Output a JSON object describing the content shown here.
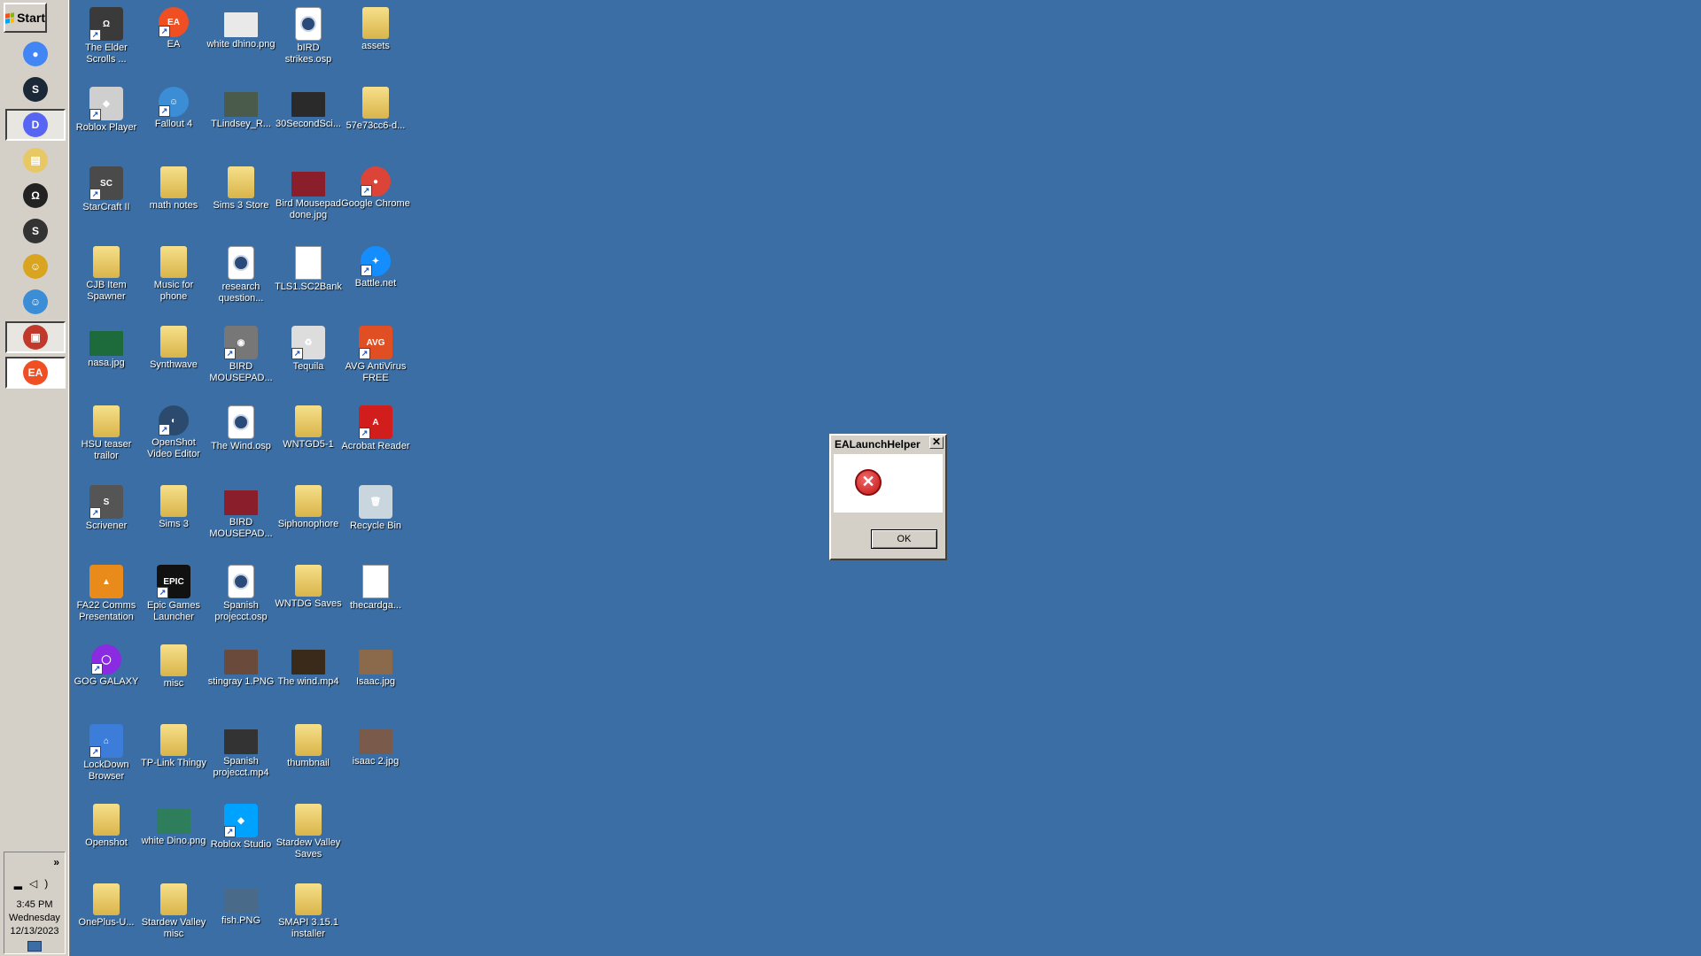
{
  "taskbar": {
    "start_label": "Start",
    "pinned": [
      {
        "name": "chrome-icon",
        "color": "#4285f4",
        "glyph": "●"
      },
      {
        "name": "steam-icon",
        "color": "#1b2838",
        "glyph": "S"
      },
      {
        "name": "discord-icon",
        "color": "#5865f2",
        "glyph": "D",
        "state": "pressed"
      },
      {
        "name": "file-explorer-icon",
        "color": "#e8c765",
        "glyph": "▤"
      },
      {
        "name": "elder-scrolls-icon",
        "color": "#222222",
        "glyph": "Ω"
      },
      {
        "name": "scrivener-icon",
        "color": "#333333",
        "glyph": "S"
      },
      {
        "name": "fallout-icon",
        "color": "#d9a520",
        "glyph": "☺"
      },
      {
        "name": "fallout-4-icon",
        "color": "#3b8ed6",
        "glyph": "☺"
      },
      {
        "name": "toolbox-icon",
        "color": "#c0392b",
        "glyph": "▣",
        "state": "pressed"
      },
      {
        "name": "ea-icon",
        "color": "#f04e23",
        "glyph": "EA",
        "state": "active"
      }
    ],
    "tray": {
      "time": "3:45 PM",
      "day": "Wednesday",
      "date": "12/13/2023",
      "chevron": "»"
    }
  },
  "desktop": {
    "columns": [
      [
        {
          "label": "The Elder Scrolls ...",
          "kind": "app",
          "color": "#3a3a3a",
          "glyph": "Ω",
          "shortcut": true
        },
        {
          "label": "Roblox Player",
          "kind": "app",
          "color": "#cfcfcf",
          "glyph": "◆",
          "shortcut": true
        },
        {
          "label": "StarCraft II",
          "kind": "app",
          "color": "#4a4a4a",
          "glyph": "SC",
          "shortcut": true
        },
        {
          "label": "CJB Item Spawner",
          "kind": "folder"
        },
        {
          "label": "nasa.jpg",
          "kind": "image",
          "color": "#1d6b3a"
        },
        {
          "label": "HSU teaser trailor",
          "kind": "folder"
        },
        {
          "label": "Scrivener",
          "kind": "app",
          "color": "#555555",
          "glyph": "S",
          "shortcut": true
        },
        {
          "label": "FA22 Comms Presentation",
          "kind": "app",
          "color": "#e98b1b",
          "glyph": "▲",
          "shortcut": false
        },
        {
          "label": "GOG GALAXY",
          "kind": "round",
          "color": "#8a2be2",
          "glyph": "◯",
          "shortcut": true
        },
        {
          "label": "LockDown Browser",
          "kind": "app",
          "color": "#3b7dd8",
          "glyph": "⌂",
          "shortcut": true
        },
        {
          "label": "Openshot",
          "kind": "folder"
        },
        {
          "label": "OnePlus-U...",
          "kind": "folder"
        }
      ],
      [
        {
          "label": "EA",
          "kind": "round",
          "color": "#f04e23",
          "glyph": "EA",
          "shortcut": true
        },
        {
          "label": "Fallout 4",
          "kind": "round",
          "color": "#3b8ed6",
          "glyph": "☺",
          "shortcut": true
        },
        {
          "label": "math notes",
          "kind": "folder"
        },
        {
          "label": "Music for phone",
          "kind": "folder"
        },
        {
          "label": "Synthwave",
          "kind": "folder"
        },
        {
          "label": "OpenShot Video Editor",
          "kind": "round",
          "color": "#2c4a6e",
          "glyph": "◐",
          "shortcut": true
        },
        {
          "label": "Sims 3",
          "kind": "folder"
        },
        {
          "label": "Epic Games Launcher",
          "kind": "app",
          "color": "#111111",
          "glyph": "EPIC",
          "shortcut": true
        },
        {
          "label": "misc",
          "kind": "folder"
        },
        {
          "label": "TP-Link Thingy",
          "kind": "folder"
        },
        {
          "label": "white Dino.png",
          "kind": "image",
          "color": "#2e7d5b"
        },
        {
          "label": "Stardew Valley misc",
          "kind": "folder"
        }
      ],
      [
        {
          "label": "white dhino.png",
          "kind": "image",
          "color": "#e9e9e9"
        },
        {
          "label": "TLindsey_R...",
          "kind": "image",
          "color": "#4b5b4b"
        },
        {
          "label": "Sims 3 Store",
          "kind": "folder"
        },
        {
          "label": "research question...",
          "kind": "osp"
        },
        {
          "label": "BIRD MOUSEPAD...",
          "kind": "app",
          "color": "#777777",
          "glyph": "◉",
          "shortcut": true
        },
        {
          "label": "The Wind.osp",
          "kind": "osp"
        },
        {
          "label": "BIRD MOUSEPAD...",
          "kind": "image",
          "color": "#8a1e2b"
        },
        {
          "label": "Spanish projecct.osp",
          "kind": "osp"
        },
        {
          "label": "stingray 1.PNG",
          "kind": "image",
          "color": "#6a4a3a"
        },
        {
          "label": "Spanish projecct.mp4",
          "kind": "image",
          "color": "#333333"
        },
        {
          "label": "Roblox Studio",
          "kind": "app",
          "color": "#00a2ff",
          "glyph": "◆",
          "shortcut": true
        },
        {
          "label": "fish.PNG",
          "kind": "image",
          "color": "#4a6a8a"
        }
      ],
      [
        {
          "label": "bIRD strikes.osp",
          "kind": "osp"
        },
        {
          "label": "30SecondSci...",
          "kind": "image",
          "color": "#2a2a2a"
        },
        {
          "label": "Bird Mousepad done.jpg",
          "kind": "image",
          "color": "#8a1e2b"
        },
        {
          "label": "TLS1.SC2Bank",
          "kind": "file"
        },
        {
          "label": "Tequila",
          "kind": "app",
          "color": "#dddddd",
          "glyph": "♻",
          "shortcut": true
        },
        {
          "label": "WNTGD5-1",
          "kind": "folder"
        },
        {
          "label": "Siphonophore",
          "kind": "folder"
        },
        {
          "label": "WNTDG Saves",
          "kind": "folder"
        },
        {
          "label": "The wind.mp4",
          "kind": "image",
          "color": "#3a2a1a"
        },
        {
          "label": "thumbnail",
          "kind": "folder"
        },
        {
          "label": "Stardew Valley Saves",
          "kind": "folder"
        },
        {
          "label": "SMAPI 3.15.1 installer",
          "kind": "folder"
        }
      ],
      [
        {
          "label": "assets",
          "kind": "folder"
        },
        {
          "label": "57e73cc6-d...",
          "kind": "folder"
        },
        {
          "label": "Google Chrome",
          "kind": "round",
          "color": "#db4437",
          "glyph": "●",
          "shortcut": true
        },
        {
          "label": "Battle.net",
          "kind": "round",
          "color": "#148eff",
          "glyph": "✦",
          "shortcut": true
        },
        {
          "label": "AVG AntiVirus FREE",
          "kind": "app",
          "color": "#e04e24",
          "glyph": "AVG",
          "shortcut": true
        },
        {
          "label": "Acrobat Reader",
          "kind": "app",
          "color": "#d21d1d",
          "glyph": "A",
          "shortcut": true
        },
        {
          "label": "Recycle Bin",
          "kind": "app",
          "color": "#c9d6de",
          "glyph": "🗑",
          "shortcut": false
        },
        {
          "label": "thecardga...",
          "kind": "file"
        },
        {
          "label": "Isaac.jpg",
          "kind": "image",
          "color": "#8a6a4a"
        },
        {
          "label": "isaac 2.jpg",
          "kind": "image",
          "color": "#7a5a4a"
        }
      ]
    ]
  },
  "dialog": {
    "title": "EALaunchHelper",
    "close_glyph": "✕",
    "error_glyph": "✕",
    "ok_label": "OK"
  }
}
